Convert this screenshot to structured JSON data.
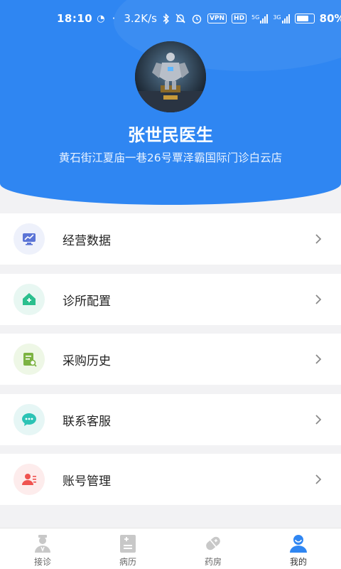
{
  "status_bar": {
    "time": "18:10",
    "speed": "3.2K/s",
    "vpn": "VPN",
    "hd": "HD",
    "net1": "5G",
    "net2": "3G",
    "battery_text": "80%",
    "battery_level": 0.8
  },
  "profile": {
    "name": "张世民医生",
    "address": "黄石街江夏庙一巷26号覃泽霸国际门诊白云店",
    "avatar_icon": "robot-avatar-image"
  },
  "menu": [
    {
      "label": "经营数据",
      "icon": "chart-monitor-icon",
      "icon_bg": "#eef1fb",
      "icon_color": "#5b74d6"
    },
    {
      "label": "诊所配置",
      "icon": "clinic-home-icon",
      "icon_bg": "#e8f7f2",
      "icon_color": "#2bbf8e"
    },
    {
      "label": "采购历史",
      "icon": "purchase-doc-icon",
      "icon_bg": "#eef7e6",
      "icon_color": "#7cb342"
    },
    {
      "label": "联系客服",
      "icon": "chat-bubble-icon",
      "icon_bg": "#e6f6f5",
      "icon_color": "#2cc3b5"
    },
    {
      "label": "账号管理",
      "icon": "account-user-icon",
      "icon_bg": "#fdecec",
      "icon_color": "#ef5350"
    }
  ],
  "tabs": [
    {
      "label": "接诊",
      "icon": "doctor-icon",
      "active": false
    },
    {
      "label": "病历",
      "icon": "record-icon",
      "active": false
    },
    {
      "label": "药房",
      "icon": "pill-icon",
      "active": false
    },
    {
      "label": "我的",
      "icon": "profile-icon",
      "active": true
    }
  ],
  "colors": {
    "header_blue": "#2f86f2",
    "tab_active": "#2f86f2",
    "tab_inactive": "#c8c8c8",
    "chevron": "#8a8a8a"
  }
}
